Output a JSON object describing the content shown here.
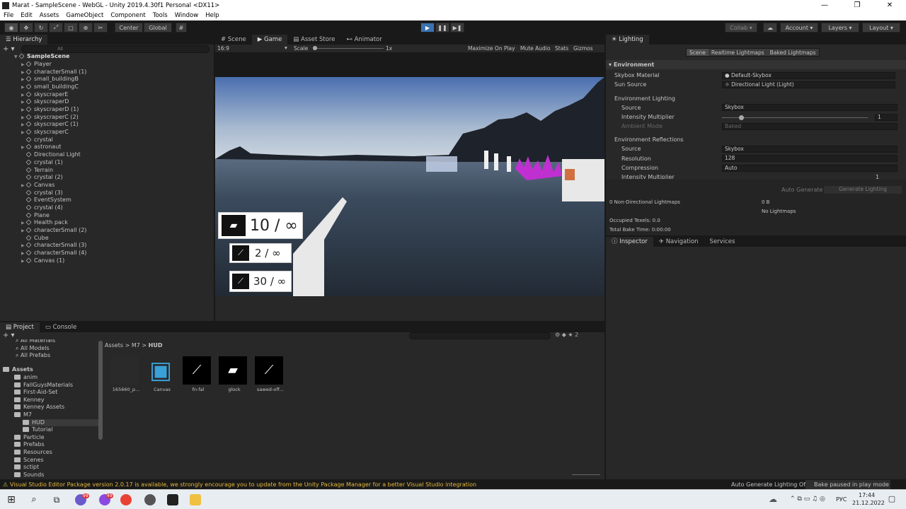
{
  "window": {
    "title": "Marat - SampleScene - WebGL - Unity 2019.4.30f1 Personal <DX11>"
  },
  "menu": [
    "File",
    "Edit",
    "Assets",
    "GameObject",
    "Component",
    "Tools",
    "Window",
    "Help"
  ],
  "toolbar": {
    "center": "Center",
    "global": "Global",
    "collab": "Collab",
    "account": "Account",
    "layers": "Layers",
    "layout": "Layout"
  },
  "hierarchy": {
    "tab": "Hierarchy",
    "search_placeholder": "All",
    "scene": "SampleScene",
    "items": [
      "Player",
      "characterSmall (1)",
      "small_buildingB",
      "small_buildingC",
      "skyscraperE",
      "skyscraperD",
      "skyscraperD (1)",
      "skyscraperC (2)",
      "skyscraperC (1)",
      "skyscraperC",
      "crystal",
      "astronaut",
      "Directional Light",
      "crystal (1)",
      "Terrain",
      "crystal (2)",
      "Canvas",
      "crystal (3)",
      "EventSystem",
      "crystal (4)",
      "Plane",
      "Health pack",
      "characterSmall (2)",
      "Cube",
      "characterSmall (3)",
      "characterSmall (4)",
      "Canvas (1)"
    ]
  },
  "game": {
    "tabs": [
      "Scene",
      "Game",
      "Asset Store",
      "Animator"
    ],
    "aspect": "16:9",
    "scale_label": "Scale",
    "scale_value": "1x",
    "options": [
      "Maximize On Play",
      "Mute Audio",
      "Stats",
      "Gizmos"
    ],
    "hud": {
      "primary": "10 / ∞",
      "secondary": "2 / ∞",
      "tertiary": "30 / ∞"
    }
  },
  "lighting": {
    "tab": "Lighting",
    "subtabs": [
      "Scene",
      "Realtime Lightmaps",
      "Baked Lightmaps"
    ],
    "section": "Environment",
    "skybox_material_label": "Skybox Material",
    "skybox_material": "Default-Skybox",
    "sun_source_label": "Sun Source",
    "sun_source": "Directional Light (Light)",
    "env_lighting": "Environment Lighting",
    "source_label": "Source",
    "source": "Skybox",
    "intensity_label": "Intensity Multiplier",
    "intensity": "1",
    "ambient_label": "Ambient Mode",
    "ambient": "Baked",
    "env_reflections": "Environment Reflections",
    "refl_source": "Skybox",
    "resolution_label": "Resolution",
    "resolution": "128",
    "compression_label": "Compression",
    "compression": "Auto",
    "refl_intensity_label": "Intensity Multiplier",
    "refl_intensity": "1",
    "auto_generate": "Auto Generate",
    "generate": "Generate Lighting",
    "non_dir": "0 Non-Directional Lightmaps",
    "size": "0 B",
    "no_lightmaps": "No Lightmaps",
    "occupied": "Occupied Texels: 0.0",
    "bake_time": "Total Bake Time: 0:00:00"
  },
  "inspector": {
    "tabs": [
      "Inspector",
      "Navigation",
      "Services"
    ]
  },
  "project": {
    "tabs": [
      "Project",
      "Console"
    ],
    "favorites": [
      "All Materials",
      "All Models",
      "All Prefabs"
    ],
    "assets_root": "Assets",
    "tree": [
      "anim",
      "FallGuysMaterials",
      "First-Aid-Set",
      "Kenney",
      "Kenney Assets",
      "M7",
      "HUD",
      "Tutorial",
      "Particle",
      "Prefabs",
      "Resources",
      "Scenes",
      "sctipt",
      "Sounds"
    ],
    "breadcrumb": [
      "Assets",
      "M7",
      "HUD"
    ],
    "files": [
      "165660_p...",
      "Canvas",
      "fn-fal",
      "glock",
      "sawed-off..."
    ],
    "hidden_count": "2"
  },
  "status": {
    "warning": "Visual Studio Editor Package version 2.0.17 is available, we strongly encourage you to update from the Unity Package Manager for a better Visual Studio integration",
    "auto_lighting": "Auto Generate Lighting Off",
    "bake": "Bake paused in play mode"
  },
  "taskbar": {
    "lang": "РУС",
    "time": "17:44",
    "date": "21.12.2022",
    "badge1": "99",
    "badge2": "49"
  },
  "colors": {
    "accent": "#3a72b0",
    "warning": "#e5b83c",
    "panel": "#282828",
    "dark": "#191919"
  }
}
